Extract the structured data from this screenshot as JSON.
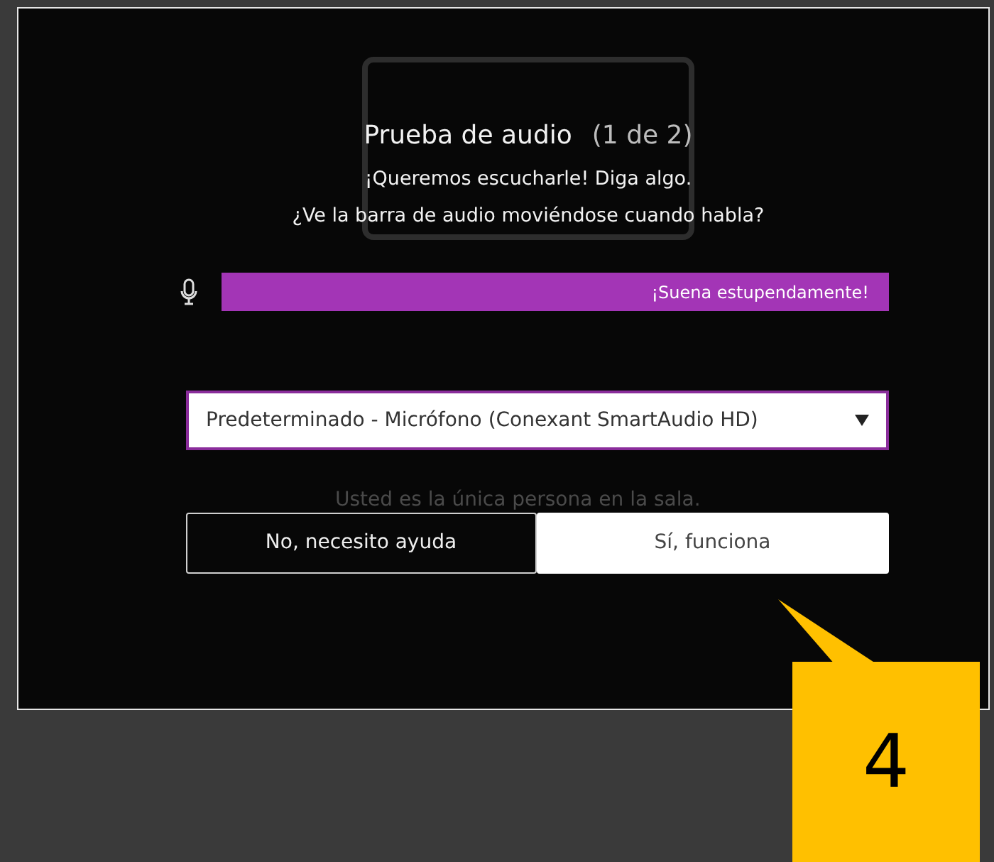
{
  "background": {
    "texts": [
      {
        "text": "Usted es la única persona en la sala."
      }
    ]
  },
  "dialog": {
    "title": "Prueba de audio",
    "step": "(1 de 2)",
    "prompts": [
      "¡Queremos escucharle! Diga algo.",
      "¿Ve la barra de audio moviéndose cuando habla?"
    ],
    "meter": {
      "level": 1,
      "reading": "¡Suena estupendamente!"
    },
    "device_select": {
      "value": "Predeterminado - Micrófono (Conexant SmartAudio HD)"
    },
    "buttons": [
      {
        "label": "No, necesito ayuda",
        "kind": "secondary"
      },
      {
        "label": "Sí, funciona",
        "kind": "primary"
      }
    ]
  },
  "callout": {
    "text": "4"
  }
}
